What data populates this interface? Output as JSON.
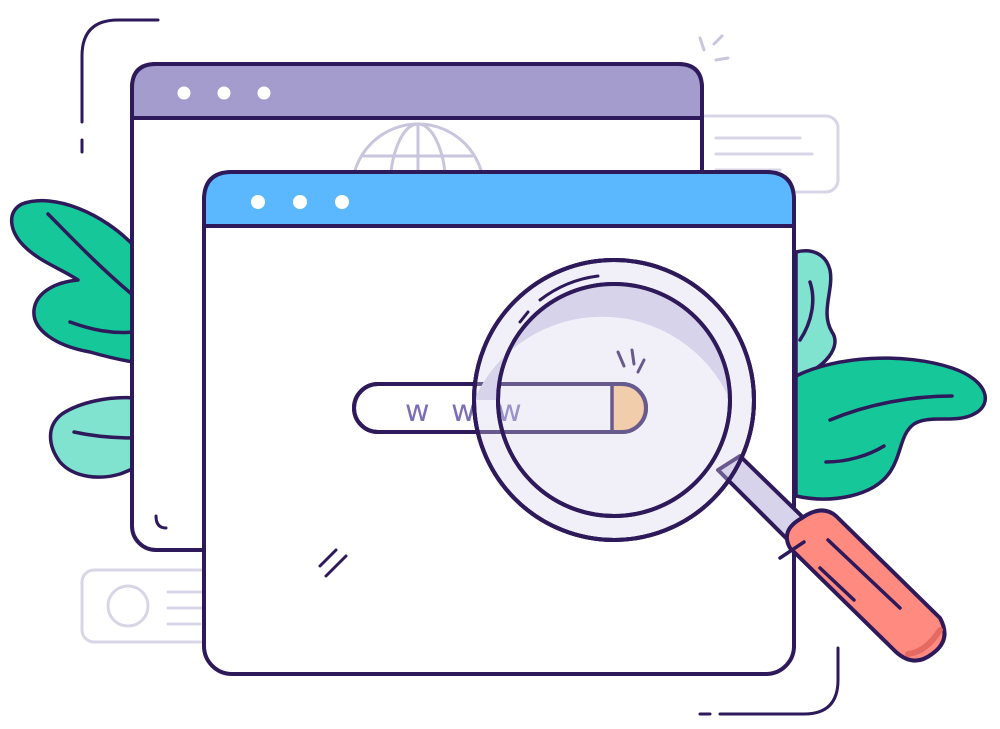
{
  "search": {
    "url_text": "w w w"
  },
  "colors": {
    "outline": "#2e1a5b",
    "back_window_bar": "#a39ccd",
    "front_window_bar": "#5bb8ff",
    "window_fill": "#ffffff",
    "back_window_fill": "#f6f5fb",
    "leaf_dark": "#16c79a",
    "leaf_light": "#7fe3d0",
    "handle": "#ff8a80",
    "handle_shadow": "#e56a63",
    "lens_ring": "#d7d3ea",
    "cursor": "#ffc98a",
    "faint_line": "#d8d5e6",
    "url_text": "#7a70b8"
  },
  "icons": [
    "globe-icon",
    "magnifying-glass-icon",
    "avatar-icon",
    "sparkle-icon"
  ]
}
